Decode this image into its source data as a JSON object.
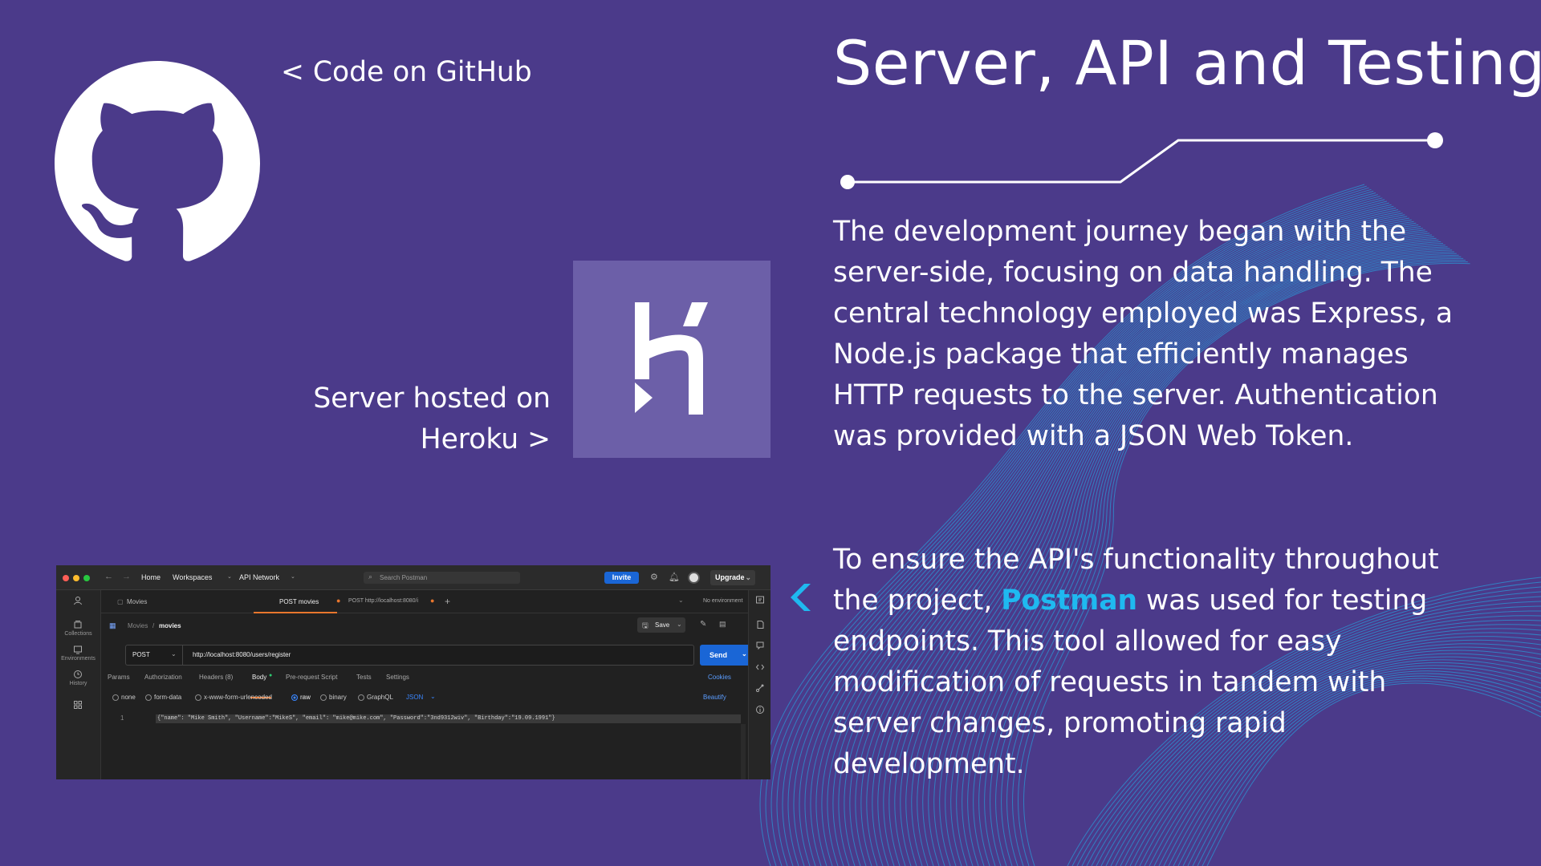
{
  "slide": {
    "title": "Server, API and Testing",
    "github_link": "< Code on GitHub",
    "heroku_label_line1": "Server hosted on",
    "heroku_label_line2": "Heroku >",
    "paragraph1": "The development journey began with the server-side, focusing on data handling. The central technology employed was Express, a Node.js package that efficiently manages HTTP requests to the server. Authentication was provided with a JSON Web Token.",
    "paragraph2_before": "To ensure the API's functionality throughout the project, ",
    "paragraph2_highlight": "Postman",
    "paragraph2_after": " was used for testing endpoints. This tool allowed for easy modification of requests in tandem with server changes, promoting rapid development.",
    "colors": {
      "background": "#4b3a8a",
      "highlight": "#1fb9f0",
      "heroku_tile": "#6c5fa8",
      "wave": "#1fb9f0"
    },
    "icons": [
      "github-icon",
      "heroku-icon",
      "chevron-left-icon"
    ]
  },
  "postman": {
    "nav": {
      "home": "Home",
      "workspaces": "Workspaces",
      "api_network": "API Network"
    },
    "search_placeholder": "Search Postman",
    "invite": "Invite",
    "upgrade": "Upgrade",
    "sidebar": [
      "Collections",
      "Environments",
      "History"
    ],
    "tabs": [
      {
        "label": "Movies"
      },
      {
        "label": "POST movies"
      },
      {
        "label": "POST http://localhost:8080/i"
      }
    ],
    "environment": "No environment",
    "breadcrumb_parent": "Movies",
    "breadcrumb_sep": "/",
    "breadcrumb_current": "movies",
    "save": "Save",
    "method": "POST",
    "url": "http://localhost:8080/users/register",
    "send": "Send",
    "request_tabs": [
      "Params",
      "Authorization",
      "Headers (8)",
      "Body",
      "Pre-request Script",
      "Tests",
      "Settings"
    ],
    "cookies": "Cookies",
    "body_types": [
      "none",
      "form-data",
      "x-www-form-urlencoded",
      "raw",
      "binary",
      "GraphQL"
    ],
    "body_format": "JSON",
    "beautify": "Beautify",
    "line_number": "1",
    "code": "{\"name\": \"Mike Smith\", \"Username\":\"MikeS\", \"email\": \"mike@mike.com\", \"Password\":\"3nd9312wiv\", \"Birthday\":\"19.09.1991\"}"
  }
}
